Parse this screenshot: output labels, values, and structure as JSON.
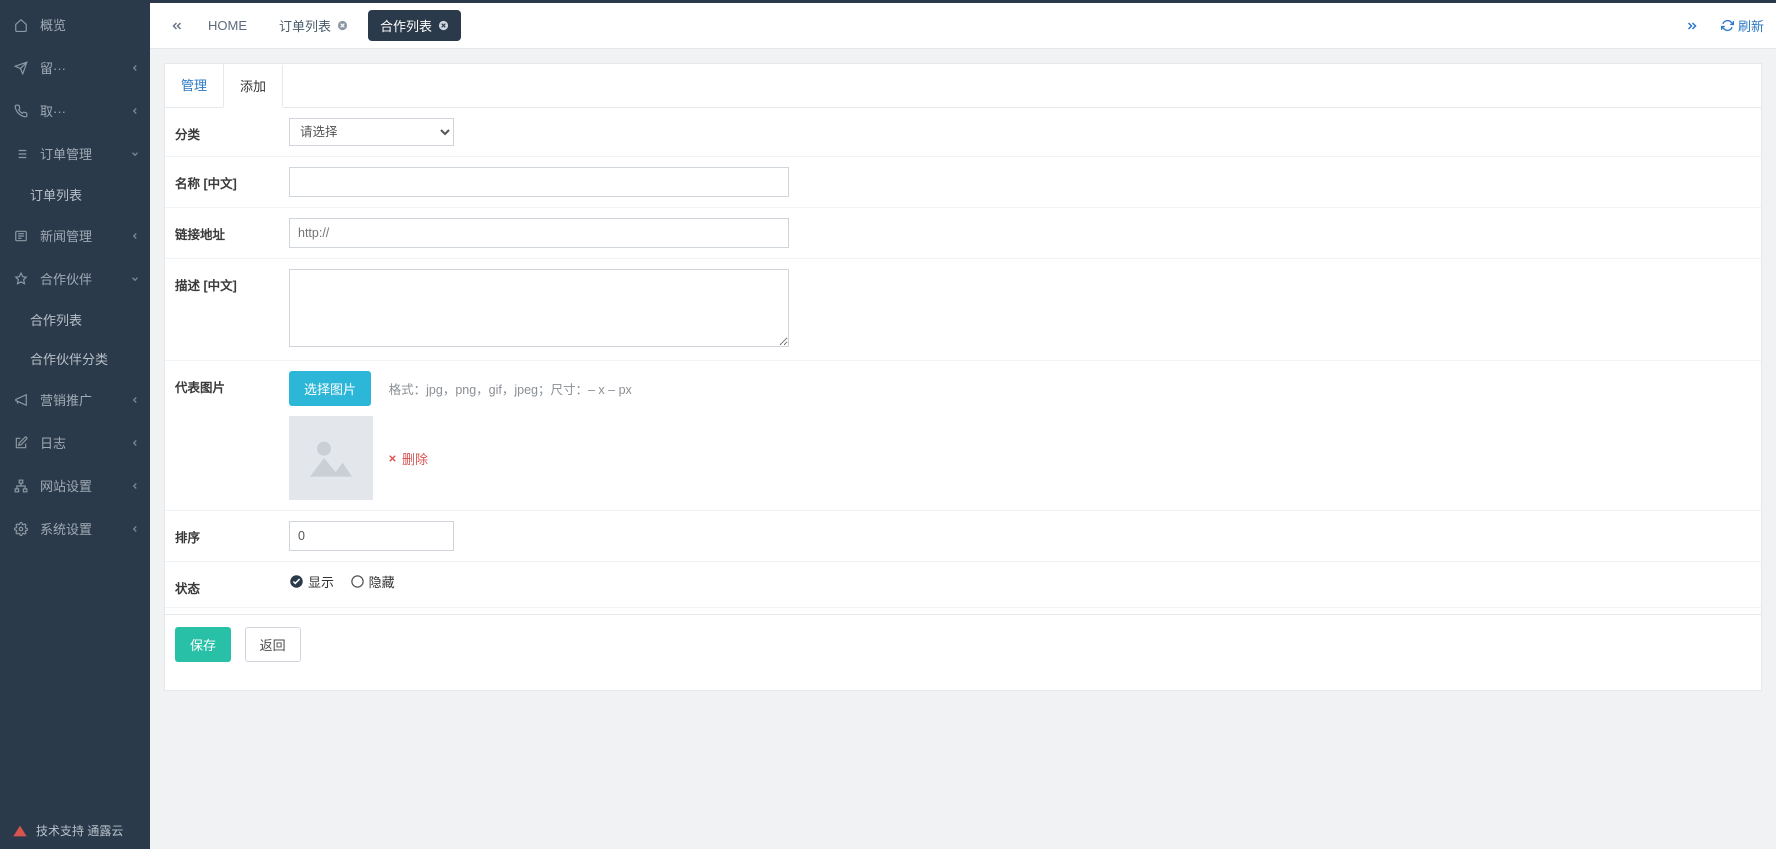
{
  "sidebar": {
    "overview": "概览",
    "leave": "留···",
    "take": "取···",
    "order_mgmt": "订单管理",
    "order_list": "订单列表",
    "news_mgmt": "新闻管理",
    "partner": "合作伙伴",
    "partner_list": "合作列表",
    "partner_cat": "合作伙伴分类",
    "marketing": "营销推广",
    "log": "日志",
    "site_setting": "网站设置",
    "sys_setting": "系统设置",
    "footer": "技术支持 通露云"
  },
  "topbar": {
    "home": "HOME",
    "tab1": "订单列表",
    "tab2": "合作列表",
    "refresh": "刷新"
  },
  "subtabs": {
    "manage": "管理",
    "add": "添加"
  },
  "form": {
    "category_label": "分类",
    "category_placeholder": "请选择",
    "name_label": "名称 [中文]",
    "link_label": "链接地址",
    "link_placeholder": "http://",
    "desc_label": "描述 [中文]",
    "image_label": "代表图片",
    "select_image_btn": "选择图片",
    "image_hint": "格式：jpg，png，gif，jpeg；尺寸：– x – px",
    "delete": "删除",
    "sort_label": "排序",
    "sort_value": "0",
    "status_label": "状态",
    "status_show": "显示",
    "status_hide": "隐藏",
    "save": "保存",
    "back": "返回"
  }
}
